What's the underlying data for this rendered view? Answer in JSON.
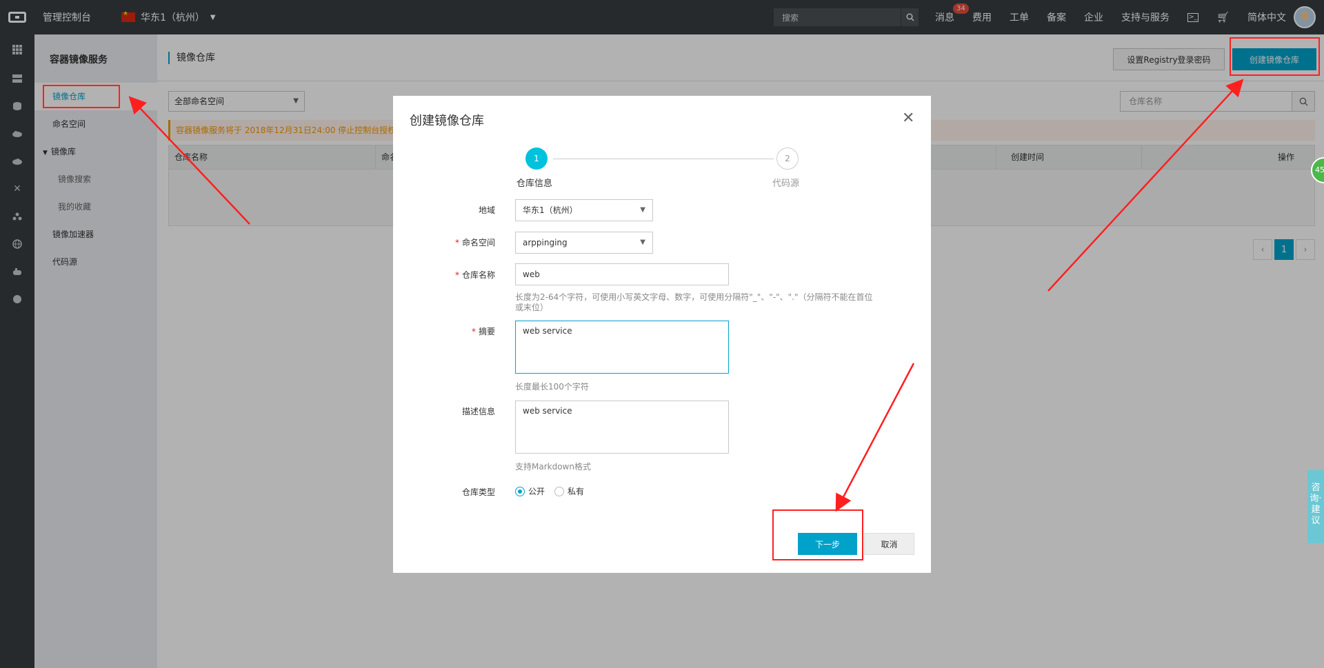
{
  "topbar": {
    "console_title": "管理控制台",
    "region": "华东1（杭州）",
    "search_placeholder": "搜索",
    "nav": [
      "消息",
      "费用",
      "工单",
      "备案",
      "企业",
      "支持与服务"
    ],
    "message_badge": "34",
    "language": "简体中文"
  },
  "sidebar": {
    "title": "容器镜像服务",
    "items": [
      "镜像仓库",
      "命名空间",
      "镜像库",
      "镜像搜索",
      "我的收藏",
      "镜像加速器",
      "代码源"
    ]
  },
  "main": {
    "page_title": "镜像仓库",
    "registry_password_button": "设置Registry登录密码",
    "create_repo_button": "创建镜像仓库",
    "namespace_filter": "全部命名空间",
    "repo_search_placeholder": "仓库名称",
    "notice": "容器镜像服务将于 2018年12月31日24:00 停止控制台授权权",
    "table_headers": [
      "仓库名称",
      "命名",
      "创建时间",
      "操作"
    ],
    "pager_current": "1"
  },
  "dialog": {
    "title": "创建镜像仓库",
    "steps": [
      {
        "number": "1",
        "label": "仓库信息"
      },
      {
        "number": "2",
        "label": "代码源"
      }
    ],
    "fields": {
      "region_label": "地域",
      "region_value": "华东1（杭州）",
      "namespace_label": "命名空间",
      "namespace_value": "arppinging",
      "name_label": "仓库名称",
      "name_value": "web",
      "name_help_1": "长度为2-64个字符，可使用小写英文字母、数字，可使用分隔符\"_\"、\"-\"、\".\"（分隔符不能在首位",
      "name_help_2": "或末位）",
      "summary_label": "摘要",
      "summary_value": "web service",
      "summary_help": "长度最长100个字符",
      "desc_label": "描述信息",
      "desc_value": "web service",
      "desc_help": "支持Markdown格式",
      "type_label": "仓库类型",
      "type_public": "公开",
      "type_private": "私有"
    },
    "next_button": "下一步",
    "cancel_button": "取消"
  },
  "widgets": {
    "float_badge": "45",
    "feedback": "咨询·建议"
  },
  "colors": {
    "accent": "#00a2ca",
    "topbar": "#373d41",
    "annotation_red": "#ff1f1f"
  }
}
